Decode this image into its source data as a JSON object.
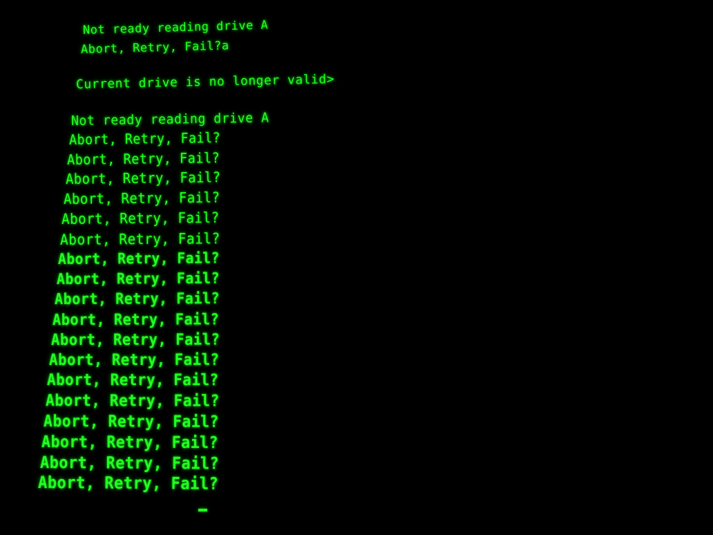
{
  "terminal": {
    "header_lines": [
      "Not ready reading drive A",
      "Abort, Retry, Fail?a",
      "Current drive is no longer valid>",
      "Not ready reading drive A"
    ],
    "repeat_line": "Abort, Retry, Fail?",
    "repeat_count": 18,
    "text_color": "#22ff22",
    "background_color": "#000000"
  }
}
